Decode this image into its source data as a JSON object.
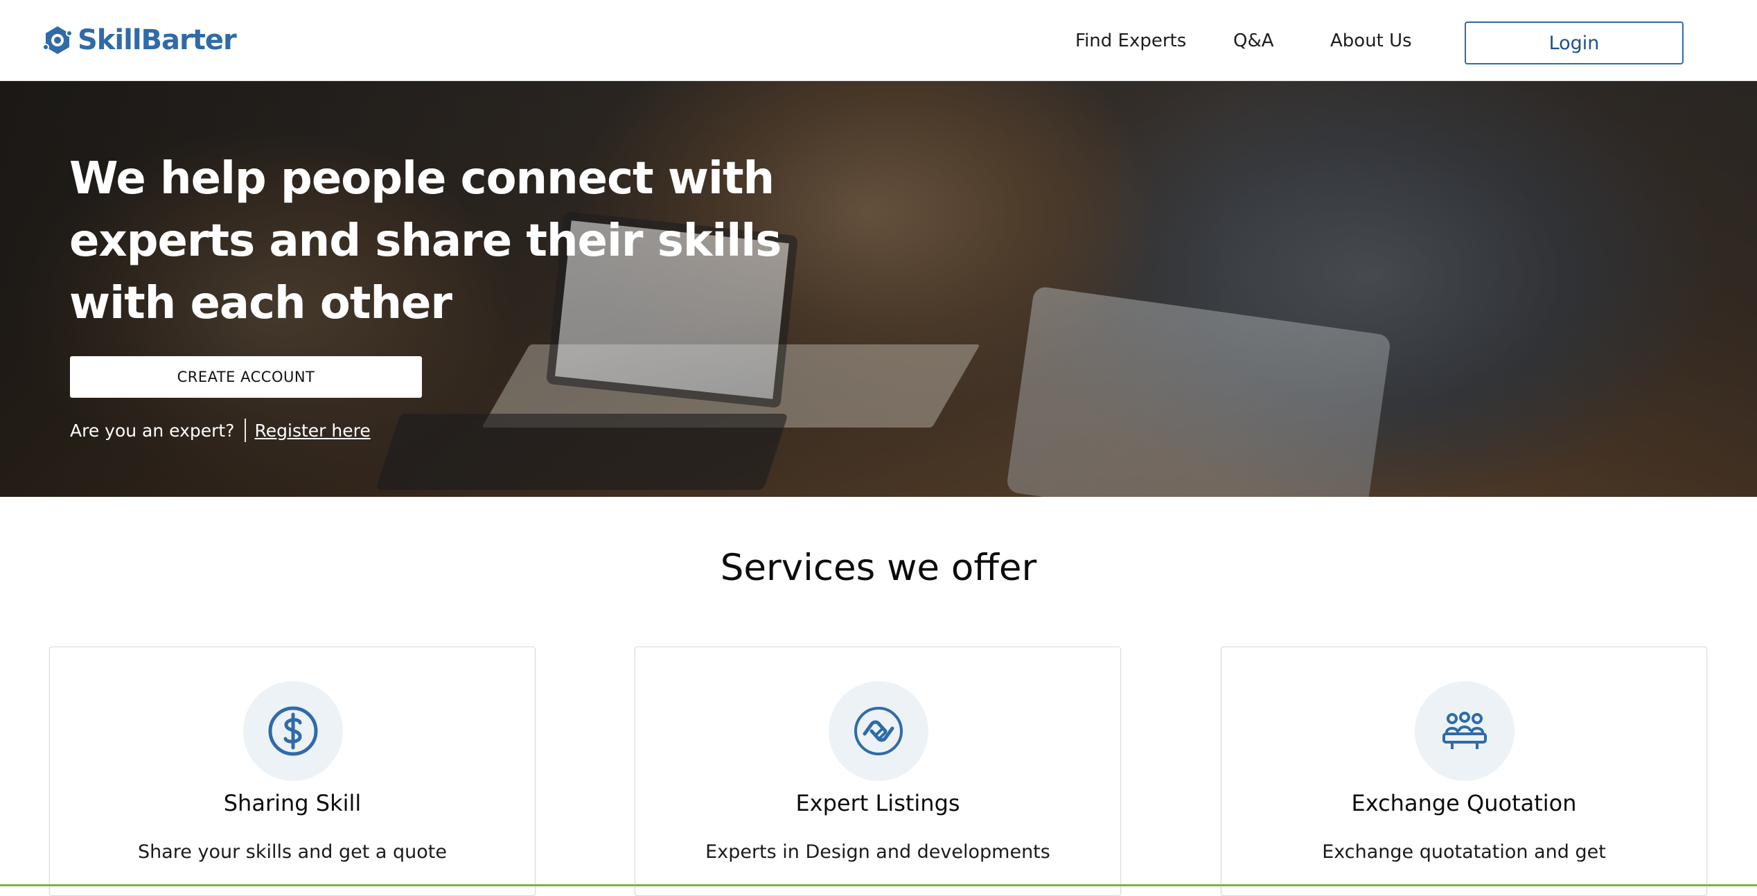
{
  "header": {
    "logo_text": "SkillBarter",
    "nav": {
      "find_experts": "Find Experts",
      "qa": "Q&A",
      "about_us": "About Us"
    },
    "login_label": "Login"
  },
  "hero": {
    "title": "We help people connect with experts and share their skills with each other",
    "create_account_label": "CREATE ACCOUNT",
    "expert_question": "Are you an expert?",
    "register_link": "Register here"
  },
  "services": {
    "title": "Services we offer",
    "cards": [
      {
        "icon": "dollar-circle-icon",
        "title": "Sharing Skill",
        "description": "Share your skills and get a quote"
      },
      {
        "icon": "handshake-icon",
        "title": "Expert Listings",
        "description": "Experts in Design and developments"
      },
      {
        "icon": "group-meeting-icon",
        "title": "Exchange Quotation",
        "description": "Exchange quotatation and get"
      }
    ]
  },
  "colors": {
    "brand": "#2f6ba8",
    "icon_bg": "#ecf2f6",
    "accent_line": "#7cb342"
  }
}
